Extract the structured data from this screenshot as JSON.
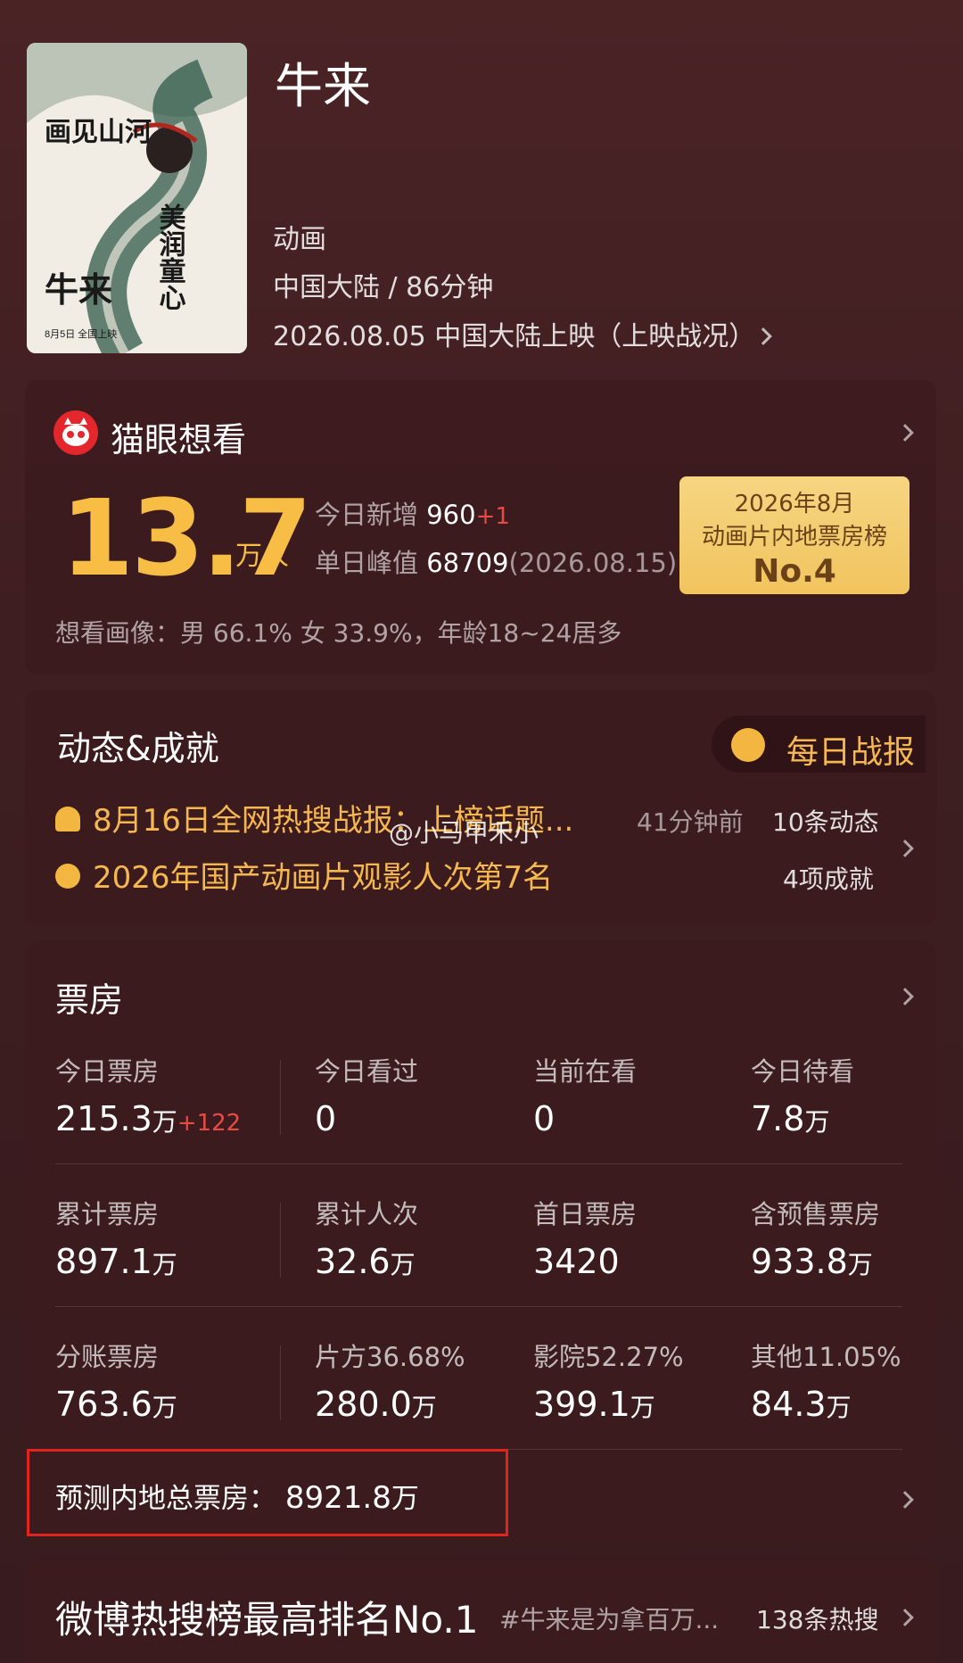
{
  "movie": {
    "title": "牛来",
    "genre": "动画",
    "region_duration": "中国大陆 / 86分钟",
    "release": "2026.08.05 中国大陆上映（上映战况）",
    "poster_text": [
      "画见山河",
      "美润童心",
      "牛来",
      "8月5日 全国上映"
    ]
  },
  "want": {
    "title": "猫眼想看",
    "total": "13.7",
    "total_unit": "万人",
    "today_label": "今日新增",
    "today_value": "960",
    "today_delta": "+1",
    "peak_label": "单日峰值",
    "peak_value": "68709",
    "peak_date": "(2026.08.15)",
    "portrait": "想看画像：男 66.1%  女 33.9%，年龄18~24居多",
    "rank": {
      "line1": "2026年8月",
      "line2": "动画片内地票房榜",
      "line3": "No.4"
    }
  },
  "dynamics": {
    "title": "动态&成就",
    "daily_report": "每日战报",
    "row1_text": "8月16日全网热搜战报：上榜话题...",
    "row1_time": "41分钟前",
    "row1_count": "10条动态",
    "row2_text": "2026年国产动画片观影人次第7名",
    "row2_count": "4项成就",
    "watermark": "@小马甲禾小"
  },
  "boxoffice": {
    "title": "票房",
    "rows": [
      [
        {
          "label": "今日票房",
          "value": "215.3",
          "unit": "万",
          "delta": "+122"
        },
        {
          "label": "今日看过",
          "value": "0",
          "unit": ""
        },
        {
          "label": "当前在看",
          "value": "0",
          "unit": ""
        },
        {
          "label": "今日待看",
          "value": "7.8",
          "unit": "万"
        }
      ],
      [
        {
          "label": "累计票房",
          "value": "897.1",
          "unit": "万"
        },
        {
          "label": "累计人次",
          "value": "32.6",
          "unit": "万"
        },
        {
          "label": "首日票房",
          "value": "3420",
          "unit": ""
        },
        {
          "label": "含预售票房",
          "value": "933.8",
          "unit": "万"
        }
      ],
      [
        {
          "label": "分账票房",
          "value": "763.6",
          "unit": "万"
        },
        {
          "label": "片方36.68%",
          "value": "280.0",
          "unit": "万"
        },
        {
          "label": "影院52.27%",
          "value": "399.1",
          "unit": "万"
        },
        {
          "label": "其他11.05%",
          "value": "84.3",
          "unit": "万"
        }
      ]
    ],
    "forecast_label": "预测内地总票房：",
    "forecast_value": "8921.8",
    "forecast_unit": "万"
  },
  "weibo": {
    "title": "微博热搜榜最高排名No.1",
    "tag": "#牛来是为拿百万...",
    "count": "138条热搜"
  },
  "colors": {
    "accent_gold": "#f7bd45",
    "delta_red": "#e84b45",
    "highlight_border": "#e0251f"
  }
}
